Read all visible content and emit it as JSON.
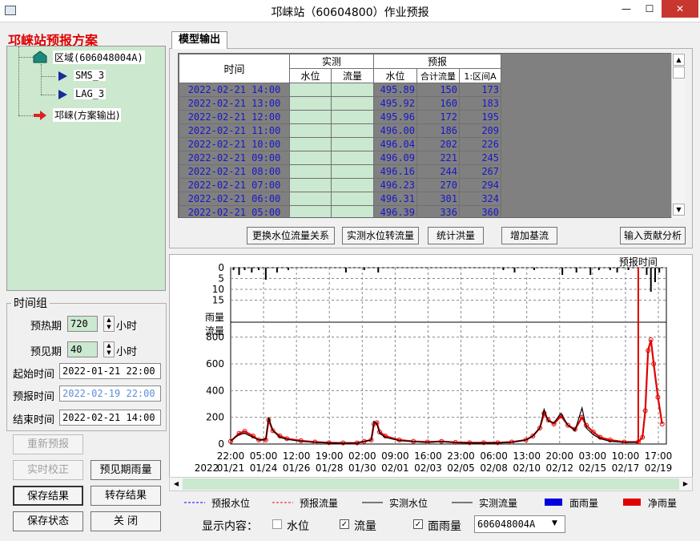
{
  "window": {
    "title": "邛崃站（60604800）作业预报",
    "min": "—",
    "max": "☐",
    "close": "✕"
  },
  "scheme": {
    "title": "邛崃站预报方案",
    "tree": [
      {
        "label": "区域(606048004A)",
        "icon": "house-icon"
      },
      {
        "label": "SMS_3",
        "icon": "flag-icon"
      },
      {
        "label": "LAG_3",
        "icon": "flag-icon"
      },
      {
        "label": "邛崃(方案输出)",
        "icon": "arrow-right-icon"
      }
    ]
  },
  "timegroup": {
    "legend": "时间组",
    "warmup_label": "预热期",
    "warmup_value": "720",
    "warmup_unit": "小时",
    "forecast_label": "预见期",
    "forecast_value": "40",
    "forecast_unit": "小时",
    "start_label": "起始时间",
    "start_value": "2022-01-21 22:00",
    "forecast_time_label": "预报时间",
    "forecast_time_value": "2022-02-19 22:00",
    "end_label": "结束时间",
    "end_value": "2022-02-21 14:00"
  },
  "buttons": {
    "reforecast": "重新预报",
    "realtime_correct": "实时校正",
    "foresee_rain": "预见期雨量",
    "save_result": "保存结果",
    "transfer_result": "转存结果",
    "save_state": "保存状态",
    "close": "关  闭"
  },
  "tab": {
    "label": "模型输出"
  },
  "table": {
    "head_time": "时间",
    "head_obs": "实测",
    "head_fc": "预报",
    "sub_obs_level": "水位",
    "sub_obs_flow": "流量",
    "sub_fc_level": "水位",
    "sub_fc_flow": "合计流量",
    "sub_fc_zone": "1:区间A",
    "rows": [
      {
        "time": "2022-02-21 14:00",
        "level": "495.89",
        "flow": "150",
        "zone": "173"
      },
      {
        "time": "2022-02-21 13:00",
        "level": "495.92",
        "flow": "160",
        "zone": "183"
      },
      {
        "time": "2022-02-21 12:00",
        "level": "495.96",
        "flow": "172",
        "zone": "195"
      },
      {
        "time": "2022-02-21 11:00",
        "level": "496.00",
        "flow": "186",
        "zone": "209"
      },
      {
        "time": "2022-02-21 10:00",
        "level": "496.04",
        "flow": "202",
        "zone": "226"
      },
      {
        "time": "2022-02-21 09:00",
        "level": "496.09",
        "flow": "221",
        "zone": "245"
      },
      {
        "time": "2022-02-21 08:00",
        "level": "496.16",
        "flow": "244",
        "zone": "267"
      },
      {
        "time": "2022-02-21 07:00",
        "level": "496.23",
        "flow": "270",
        "zone": "294"
      },
      {
        "time": "2022-02-21 06:00",
        "level": "496.31",
        "flow": "301",
        "zone": "324"
      },
      {
        "time": "2022-02-21 05:00",
        "level": "496.39",
        "flow": "336",
        "zone": "360"
      }
    ]
  },
  "actions": {
    "replace_relation": "更换水位流量关系",
    "obs_level_to_flow": "实测水位转流量",
    "stat_flood": "统计洪量",
    "add_baseflow": "增加基流",
    "input_contrib": "输入贡献分析"
  },
  "chart_data": {
    "type": "line",
    "forecast_time_label": "预报时间",
    "rain_label": "雨量",
    "flow_label": "流量",
    "rain_ticks": [
      "0",
      "5",
      "10",
      "15"
    ],
    "flow_ticks": [
      "0",
      "200",
      "400",
      "600",
      "800"
    ],
    "flow_ylim": [
      0,
      900
    ],
    "x_time_ticks": [
      "22:00",
      "05:00",
      "12:00",
      "19:00",
      "02:00",
      "09:00",
      "16:00",
      "23:00",
      "06:00",
      "13:00",
      "20:00",
      "03:00",
      "10:00",
      "17:00"
    ],
    "x_year": "2022",
    "x_date_ticks": [
      "01/21",
      "01/24",
      "01/26",
      "01/28",
      "01/30",
      "02/01",
      "02/03",
      "02/05",
      "02/08",
      "02/10",
      "02/12",
      "02/15",
      "02/17",
      "02/19"
    ],
    "forecast_at_day": 29.0,
    "series": [
      {
        "name": "预报流量",
        "color": "#e00000",
        "points": [
          [
            0,
            20
          ],
          [
            0.6,
            80
          ],
          [
            1,
            95
          ],
          [
            1.6,
            60
          ],
          [
            2,
            30
          ],
          [
            2.5,
            30
          ],
          [
            2.7,
            180
          ],
          [
            3,
            100
          ],
          [
            3.5,
            60
          ],
          [
            4,
            40
          ],
          [
            5,
            25
          ],
          [
            6,
            15
          ],
          [
            7,
            10
          ],
          [
            8,
            8
          ],
          [
            9,
            8
          ],
          [
            9.5,
            20
          ],
          [
            10,
            30
          ],
          [
            10.2,
            150
          ],
          [
            10.4,
            160
          ],
          [
            10.6,
            90
          ],
          [
            11,
            60
          ],
          [
            12,
            30
          ],
          [
            13,
            20
          ],
          [
            14,
            15
          ],
          [
            15,
            20
          ],
          [
            16,
            12
          ],
          [
            17,
            10
          ],
          [
            18,
            10
          ],
          [
            19,
            10
          ],
          [
            20,
            15
          ],
          [
            21,
            30
          ],
          [
            21.5,
            60
          ],
          [
            22,
            120
          ],
          [
            22.3,
            230
          ],
          [
            22.6,
            180
          ],
          [
            23,
            150
          ],
          [
            23.5,
            210
          ],
          [
            24,
            140
          ],
          [
            24.5,
            110
          ],
          [
            25,
            200
          ],
          [
            25.3,
            140
          ],
          [
            25.8,
            90
          ],
          [
            26.3,
            50
          ],
          [
            27,
            30
          ],
          [
            28,
            15
          ],
          [
            29,
            15
          ],
          [
            29.3,
            50
          ],
          [
            29.5,
            250
          ],
          [
            29.7,
            700
          ],
          [
            29.9,
            780
          ],
          [
            30.1,
            600
          ],
          [
            30.4,
            350
          ],
          [
            30.7,
            150
          ]
        ]
      },
      {
        "name": "实测流量",
        "color": "#000000",
        "points": [
          [
            0,
            25
          ],
          [
            0.6,
            70
          ],
          [
            1,
            80
          ],
          [
            1.6,
            50
          ],
          [
            2,
            30
          ],
          [
            2.5,
            40
          ],
          [
            2.7,
            200
          ],
          [
            3,
            100
          ],
          [
            3.5,
            50
          ],
          [
            4,
            35
          ],
          [
            5,
            20
          ],
          [
            6,
            12
          ],
          [
            7,
            8
          ],
          [
            8,
            6
          ],
          [
            9,
            8
          ],
          [
            9.5,
            20
          ],
          [
            10,
            30
          ],
          [
            10.2,
            170
          ],
          [
            10.4,
            150
          ],
          [
            10.6,
            80
          ],
          [
            11,
            50
          ],
          [
            12,
            25
          ],
          [
            13,
            18
          ],
          [
            14,
            12
          ],
          [
            15,
            18
          ],
          [
            16,
            10
          ],
          [
            17,
            8
          ],
          [
            18,
            8
          ],
          [
            19,
            8
          ],
          [
            20,
            12
          ],
          [
            21,
            30
          ],
          [
            21.5,
            60
          ],
          [
            22,
            120
          ],
          [
            22.3,
            260
          ],
          [
            22.6,
            170
          ],
          [
            23,
            160
          ],
          [
            23.5,
            230
          ],
          [
            24,
            140
          ],
          [
            24.5,
            100
          ],
          [
            25,
            270
          ],
          [
            25.3,
            120
          ],
          [
            25.8,
            70
          ],
          [
            26.3,
            40
          ],
          [
            27,
            20
          ],
          [
            28,
            12
          ],
          [
            29,
            12
          ]
        ]
      }
    ],
    "legend": [
      {
        "label": "预报水位",
        "style": "dash",
        "color": "#0000ff"
      },
      {
        "label": "预报流量",
        "style": "dash",
        "color": "#ff0000"
      },
      {
        "label": "实测水位",
        "style": "solid",
        "color": "#000000"
      },
      {
        "label": "实测流量",
        "style": "solid",
        "color": "#000000"
      },
      {
        "label": "面雨量",
        "style": "box",
        "color": "#0000e0"
      },
      {
        "label": "净雨量",
        "style": "box",
        "color": "#e00000"
      }
    ]
  },
  "display": {
    "label": "显示内容：",
    "level": "水位",
    "flow": "流量",
    "area_rain": "面雨量",
    "level_checked": false,
    "flow_checked": true,
    "area_rain_checked": true,
    "select_value": "606048004A"
  }
}
